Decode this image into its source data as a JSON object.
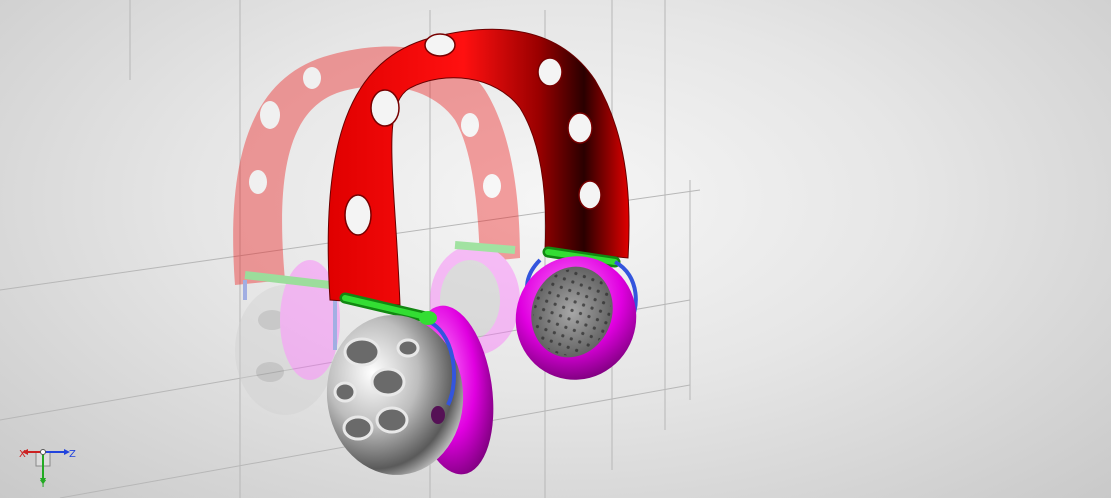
{
  "viewport": {
    "background": "#e4e4e4",
    "model": "headphones",
    "colors": {
      "headband": "#e00000",
      "headband_dark": "#3a0000",
      "cushion": "#e000e0",
      "connector": "#22cc22",
      "yoke": "#3355dd",
      "shell": "#c8c8c8"
    }
  },
  "triad": {
    "x_label": "X",
    "y_label": "Y",
    "z_label": "Z",
    "x_color": "#cc2222",
    "y_color": "#22aa22",
    "z_color": "#2244dd"
  }
}
